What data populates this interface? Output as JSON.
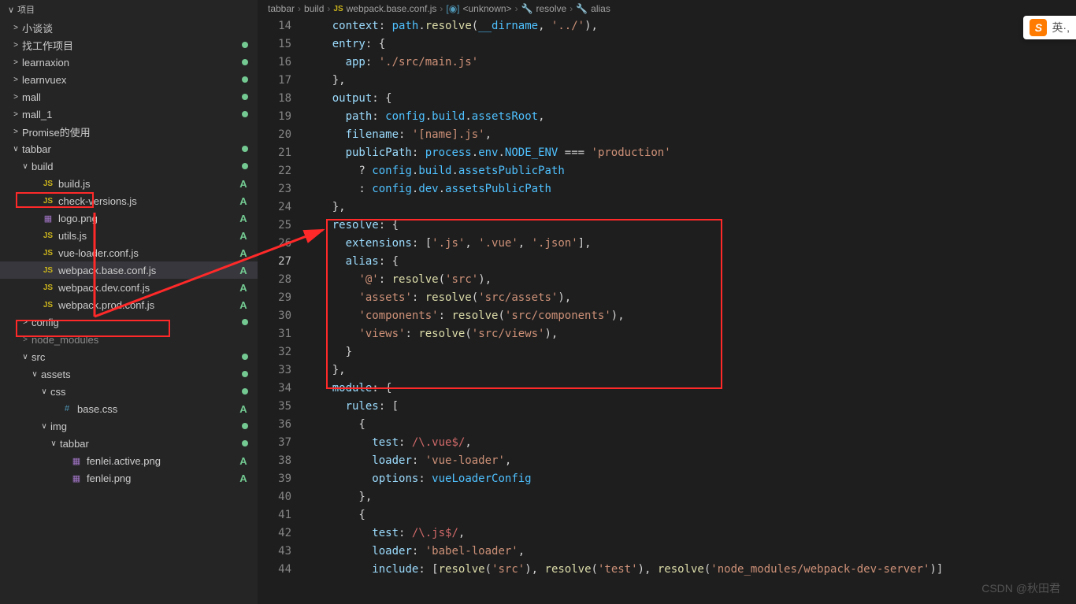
{
  "sidebar": {
    "header": "项目",
    "items": [
      {
        "label": "小谈谈",
        "type": "folder",
        "indent": 1,
        "chevron": ">",
        "badge": ""
      },
      {
        "label": "找工作项目",
        "type": "folder",
        "indent": 1,
        "chevron": ">",
        "badge": "",
        "dot": true
      },
      {
        "label": "learnaxion",
        "type": "folder",
        "indent": 1,
        "chevron": ">",
        "badge": "",
        "dot": true
      },
      {
        "label": "learnvuex",
        "type": "folder",
        "indent": 1,
        "chevron": ">",
        "badge": "",
        "dot": true
      },
      {
        "label": "mall",
        "type": "folder",
        "indent": 1,
        "chevron": ">",
        "badge": "",
        "dot": true
      },
      {
        "label": "mall_1",
        "type": "folder",
        "indent": 1,
        "chevron": ">",
        "badge": "",
        "dot": true
      },
      {
        "label": "Promise的使用",
        "type": "folder",
        "indent": 1,
        "chevron": ">",
        "badge": ""
      },
      {
        "label": "tabbar",
        "type": "folder",
        "indent": 1,
        "chevron": "∨",
        "badge": "",
        "dot": true
      },
      {
        "label": "build",
        "type": "folder",
        "indent": 2,
        "chevron": "∨",
        "badge": "",
        "dot": true,
        "redbox": true
      },
      {
        "label": "build.js",
        "type": "js",
        "indent": 3,
        "badge": "A"
      },
      {
        "label": "check-versions.js",
        "type": "js",
        "indent": 3,
        "badge": "A"
      },
      {
        "label": "logo.png",
        "type": "img",
        "indent": 3,
        "badge": "A"
      },
      {
        "label": "utils.js",
        "type": "js",
        "indent": 3,
        "badge": "A"
      },
      {
        "label": "vue-loader.conf.js",
        "type": "js",
        "indent": 3,
        "badge": "A"
      },
      {
        "label": "webpack.base.conf.js",
        "type": "js",
        "indent": 3,
        "badge": "A",
        "active": true,
        "redbox": true
      },
      {
        "label": "webpack.dev.conf.js",
        "type": "js",
        "indent": 3,
        "badge": "A"
      },
      {
        "label": "webpack.prod.conf.js",
        "type": "js",
        "indent": 3,
        "badge": "A"
      },
      {
        "label": "config",
        "type": "folder",
        "indent": 2,
        "chevron": ">",
        "badge": "",
        "dot": true
      },
      {
        "label": "node_modules",
        "type": "folder",
        "indent": 2,
        "chevron": ">",
        "badge": "",
        "dim": true
      },
      {
        "label": "src",
        "type": "folder",
        "indent": 2,
        "chevron": "∨",
        "badge": "",
        "dot": true
      },
      {
        "label": "assets",
        "type": "folder",
        "indent": 3,
        "chevron": "∨",
        "badge": "",
        "dot": true
      },
      {
        "label": "css",
        "type": "folder",
        "indent": 4,
        "chevron": "∨",
        "badge": "",
        "dot": true
      },
      {
        "label": "base.css",
        "type": "css",
        "indent": 5,
        "badge": "A"
      },
      {
        "label": "img",
        "type": "folder",
        "indent": 4,
        "chevron": "∨",
        "badge": "",
        "dot": true
      },
      {
        "label": "tabbar",
        "type": "folder",
        "indent": 5,
        "chevron": "∨",
        "badge": "",
        "dot": true
      },
      {
        "label": "fenlei.active.png",
        "type": "img",
        "indent": 6,
        "badge": "A"
      },
      {
        "label": "fenlei.png",
        "type": "img",
        "indent": 6,
        "badge": "A"
      }
    ]
  },
  "breadcrumb": {
    "items": [
      "tabbar",
      "build",
      "webpack.base.conf.js",
      "<unknown>",
      "resolve",
      "alias"
    ]
  },
  "editor": {
    "line_start": 14,
    "active_line": 27,
    "lines": [
      {
        "n": 14,
        "html": "    <span class='kw'>context</span>: <span class='prop'>path</span>.<span class='fn'>resolve</span>(<span class='prop'>__dirname</span>, <span class='str'>'../'</span>),"
      },
      {
        "n": 15,
        "html": "    <span class='kw'>entry</span>: {"
      },
      {
        "n": 16,
        "html": "      <span class='kw'>app</span>: <span class='str'>'./src/main.js'</span>"
      },
      {
        "n": 17,
        "html": "    },"
      },
      {
        "n": 18,
        "html": "    <span class='kw'>output</span>: {"
      },
      {
        "n": 19,
        "html": "      <span class='kw'>path</span>: <span class='prop'>config</span>.<span class='prop'>build</span>.<span class='prop'>assetsRoot</span>,"
      },
      {
        "n": 20,
        "html": "      <span class='kw'>filename</span>: <span class='str'>'[name].js'</span>,"
      },
      {
        "n": 21,
        "html": "      <span class='kw'>publicPath</span>: <span class='prop'>process</span>.<span class='prop'>env</span>.<span class='const'>NODE_ENV</span> === <span class='str'>'production'</span>"
      },
      {
        "n": 22,
        "html": "        ? <span class='prop'>config</span>.<span class='prop'>build</span>.<span class='prop'>assetsPublicPath</span>"
      },
      {
        "n": 23,
        "html": "        : <span class='prop'>config</span>.<span class='prop'>dev</span>.<span class='prop'>assetsPublicPath</span>"
      },
      {
        "n": 24,
        "html": "    },"
      },
      {
        "n": 25,
        "html": "    <span class='kw'>resolve</span>: {"
      },
      {
        "n": 26,
        "html": "      <span class='kw'>extensions</span>: [<span class='str'>'.js'</span>, <span class='str'>'.vue'</span>, <span class='str'>'.json'</span>],"
      },
      {
        "n": 27,
        "html": "      <span class='kw'>alias</span>: {"
      },
      {
        "n": 28,
        "html": "        <span class='str'>'@'</span>: <span class='fn'>resolve</span>(<span class='str'>'src'</span>),"
      },
      {
        "n": 29,
        "html": "        <span class='str'>'assets'</span>: <span class='fn'>resolve</span>(<span class='str'>'src/assets'</span>),"
      },
      {
        "n": 30,
        "html": "        <span class='str'>'components'</span>: <span class='fn'>resolve</span>(<span class='str'>'src/components'</span>),"
      },
      {
        "n": 31,
        "html": "        <span class='str'>'views'</span>: <span class='fn'>resolve</span>(<span class='str'>'src/views'</span>),"
      },
      {
        "n": 32,
        "html": "      }"
      },
      {
        "n": 33,
        "html": "    },"
      },
      {
        "n": 34,
        "html": "    <span class='kw'>module</span>: {"
      },
      {
        "n": 35,
        "html": "      <span class='kw'>rules</span>: ["
      },
      {
        "n": 36,
        "html": "        {"
      },
      {
        "n": 37,
        "html": "          <span class='kw'>test</span>: <span class='regex'>/\\.vue$/</span>,"
      },
      {
        "n": 38,
        "html": "          <span class='kw'>loader</span>: <span class='str'>'vue-loader'</span>,"
      },
      {
        "n": 39,
        "html": "          <span class='kw'>options</span>: <span class='prop'>vueLoaderConfig</span>"
      },
      {
        "n": 40,
        "html": "        },"
      },
      {
        "n": 41,
        "html": "        {"
      },
      {
        "n": 42,
        "html": "          <span class='kw'>test</span>: <span class='regex'>/\\.js$/</span>,"
      },
      {
        "n": 43,
        "html": "          <span class='kw'>loader</span>: <span class='str'>'babel-loader'</span>,"
      },
      {
        "n": 44,
        "html": "          <span class='kw'>include</span>: [<span class='fn'>resolve</span>(<span class='str'>'src'</span>), <span class='fn'>resolve</span>(<span class='str'>'test'</span>), <span class='fn'>resolve</span>(<span class='str'>'node_modules/webpack-dev-server'</span>)]"
      }
    ]
  },
  "ime": {
    "text": "英·,"
  },
  "watermark": "CSDN @秋田君"
}
